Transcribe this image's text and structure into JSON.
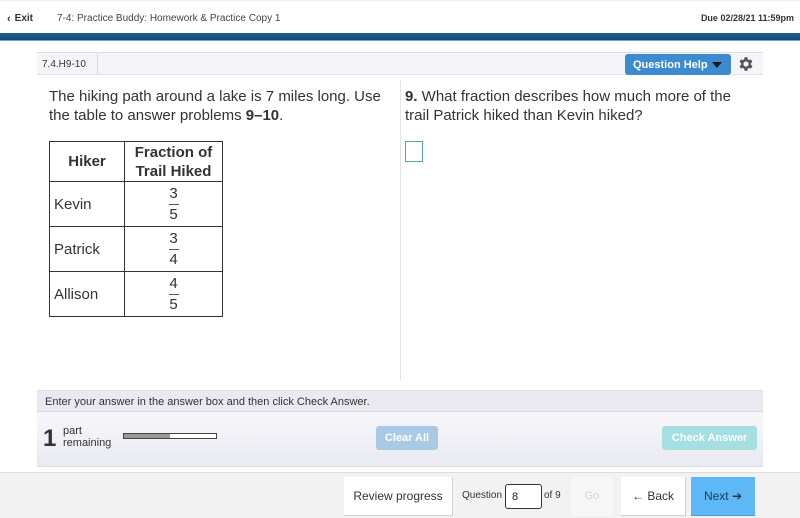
{
  "header": {
    "exit_label": "Exit",
    "exit_icon": "chevron-left-icon",
    "assignment_title": "7-4: Practice Buddy: Homework & Practice Copy 1",
    "due": "Due 02/28/21 11:59pm"
  },
  "question_header": {
    "question_id": "7.4.H9-10",
    "help_label": "Question Help",
    "help_icon": "caret-down-icon",
    "settings_icon": "gear-icon"
  },
  "prompt": {
    "text_before": "The hiking path around a lake is 7 miles long. Use the table to answer problems ",
    "bold": "9–10",
    "text_after": "."
  },
  "table": {
    "headers": [
      "Hiker",
      "Fraction of Trail Hiked"
    ],
    "rows": [
      {
        "hiker": "Kevin",
        "numerator": "3",
        "denominator": "5"
      },
      {
        "hiker": "Patrick",
        "numerator": "3",
        "denominator": "4"
      },
      {
        "hiker": "Allison",
        "numerator": "4",
        "denominator": "5"
      }
    ]
  },
  "question": {
    "number": "9.",
    "text": " What fraction describes how much more of the trail Patrick hiked than Kevin hiked?",
    "answer_value": ""
  },
  "instructions": "Enter your answer in the answer box and then click Check Answer.",
  "status": {
    "parts_remaining": "1",
    "parts_label_line1": "part",
    "parts_label_line2": "remaining",
    "progress_fraction": 0.5,
    "clear_all_label": "Clear All",
    "check_answer_label": "Check Answer"
  },
  "footer": {
    "review_label": "Review progress",
    "question_label": "Question",
    "current_question": "8",
    "of_label": "of 9",
    "go_label": "Go",
    "back_label": "← Back",
    "next_label": "Next ➔"
  }
}
